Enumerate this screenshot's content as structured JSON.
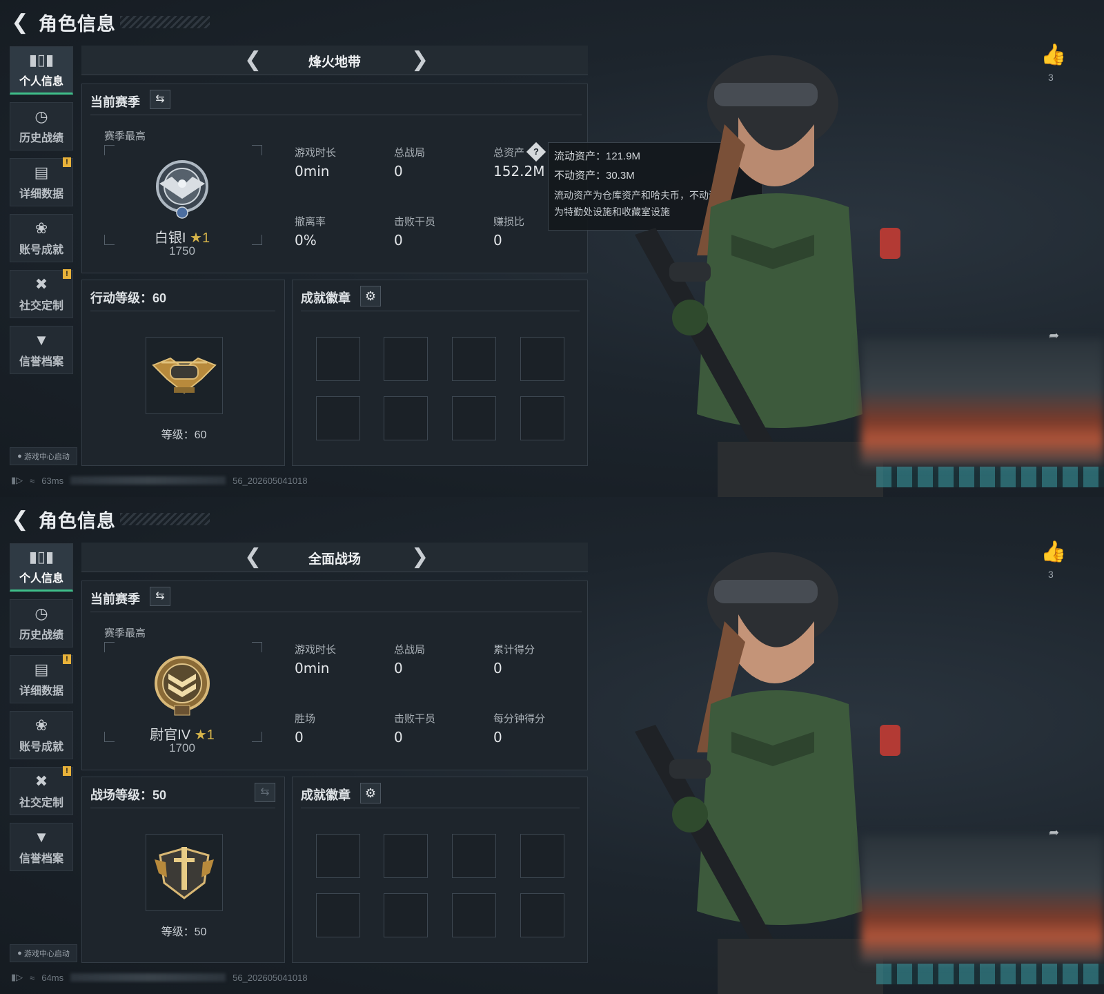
{
  "panels": [
    {
      "header": {
        "title": "角色信息"
      },
      "sidebar": [
        {
          "label": "个人信息",
          "icon": "bar-chart-icon",
          "active": true,
          "badge": ""
        },
        {
          "label": "历史战绩",
          "icon": "clock-icon",
          "badge": ""
        },
        {
          "label": "详细数据",
          "icon": "folder-icon",
          "badge": "!"
        },
        {
          "label": "账号成就",
          "icon": "medal-icon",
          "badge": ""
        },
        {
          "label": "社交定制",
          "icon": "tools-icon",
          "badge": "!"
        },
        {
          "label": "信誉档案",
          "icon": "shield-icon",
          "badge": ""
        }
      ],
      "launch_label": "游戏中心启动",
      "status": {
        "ping": "63ms",
        "build": "56_202605041018"
      },
      "mode": {
        "name": "烽火地带"
      },
      "season": {
        "title": "当前赛季",
        "best_label": "赛季最高",
        "rank_name": "白银I",
        "rank_stars": "★1",
        "rank_score": "1750",
        "stats": [
          {
            "label": "游戏时长",
            "value": "0min"
          },
          {
            "label": "总战局",
            "value": "0"
          },
          {
            "label": "总资产",
            "value": "152.2M"
          },
          {
            "label": "撤离率",
            "value": "0%"
          },
          {
            "label": "击败干员",
            "value": "0"
          },
          {
            "label": "赚损比",
            "value": "0"
          }
        ]
      },
      "tooltip": {
        "liquid": "流动资产：121.9M",
        "fixed": "不动资产：30.3M",
        "desc1": "流动资产为仓库资产和哈夫币，不动资产",
        "desc2": "为特勤处设施和收藏室设施"
      },
      "level": {
        "title": "行动等级：60",
        "text": "等级：60"
      },
      "achievements": {
        "title": "成就徽章"
      },
      "likes": {
        "count": "3"
      }
    },
    {
      "header": {
        "title": "角色信息"
      },
      "sidebar": [
        {
          "label": "个人信息",
          "icon": "bar-chart-icon",
          "active": true,
          "badge": ""
        },
        {
          "label": "历史战绩",
          "icon": "clock-icon",
          "badge": ""
        },
        {
          "label": "详细数据",
          "icon": "folder-icon",
          "badge": "!"
        },
        {
          "label": "账号成就",
          "icon": "medal-icon",
          "badge": ""
        },
        {
          "label": "社交定制",
          "icon": "tools-icon",
          "badge": "!"
        },
        {
          "label": "信誉档案",
          "icon": "shield-icon",
          "badge": ""
        }
      ],
      "launch_label": "游戏中心启动",
      "status": {
        "ping": "64ms",
        "build": "56_202605041018"
      },
      "mode": {
        "name": "全面战场"
      },
      "season": {
        "title": "当前赛季",
        "best_label": "赛季最高",
        "rank_name": "尉官IV",
        "rank_stars": "★1",
        "rank_score": "1700",
        "stats": [
          {
            "label": "游戏时长",
            "value": "0min"
          },
          {
            "label": "总战局",
            "value": "0"
          },
          {
            "label": "累计得分",
            "value": "0"
          },
          {
            "label": "胜场",
            "value": "0"
          },
          {
            "label": "击败干员",
            "value": "0"
          },
          {
            "label": "每分钟得分",
            "value": "0"
          }
        ]
      },
      "level": {
        "title": "战场等级：50",
        "text": "等级：50"
      },
      "achievements": {
        "title": "成就徽章"
      },
      "likes": {
        "count": "3"
      }
    }
  ],
  "colors": {
    "accent": "#3fbf8a",
    "badge": "#e8b23a",
    "bg": "#1a2027"
  }
}
